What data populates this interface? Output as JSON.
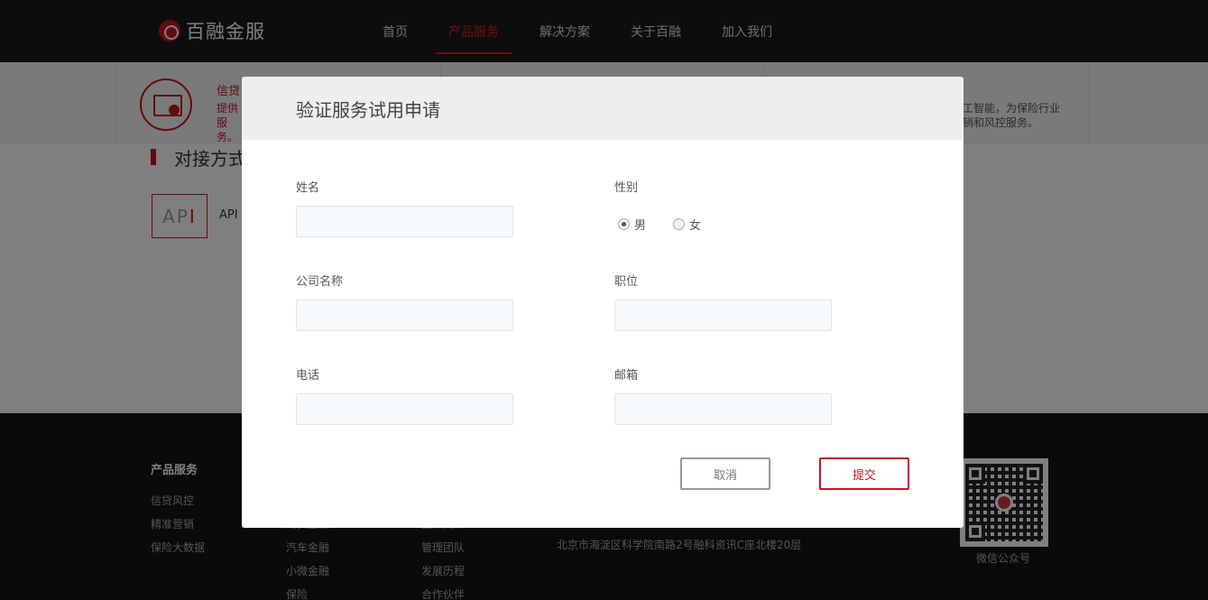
{
  "nav": {
    "logo_text": "百融金服",
    "items": [
      {
        "label": "首页",
        "active": false
      },
      {
        "label": "产品服务",
        "active": true
      },
      {
        "label": "解决方案",
        "active": false
      },
      {
        "label": "关于百融",
        "active": false
      },
      {
        "label": "加入我们",
        "active": false
      }
    ]
  },
  "submenu": {
    "credit_title": "信贷",
    "credit_desc": "提供 服务。",
    "right_desc": "工智能，为保险行业 销和风控服务。"
  },
  "content": {
    "section_title": "对接方式",
    "api_badge_a": "AP",
    "api_badge_b": "I",
    "api_label": "API"
  },
  "footer": {
    "title": "产品服务",
    "col1": [
      "信贷风控",
      "精准营销",
      "保险大数据"
    ],
    "col2": [
      "消费金融",
      "汽车金融",
      "小微金融",
      "保险"
    ],
    "col3": [
      "团队简介",
      "管理团队",
      "发展历程",
      "合作伙伴"
    ],
    "address": "北京市海淀区科学院南路2号融科资讯C座北楼20层",
    "qr_caption": "微信公众号"
  },
  "modal": {
    "title": "验证服务试用申请",
    "fields": {
      "name_label": "姓名",
      "name_value": "",
      "gender_label": "性别",
      "gender_options": [
        "男",
        "女"
      ],
      "gender_selected": "男",
      "company_label": "公司名称",
      "company_value": "",
      "position_label": "职位",
      "position_value": "",
      "phone_label": "电话",
      "phone_value": "",
      "email_label": "邮箱",
      "email_value": ""
    },
    "cancel_label": "取消",
    "submit_label": "提交"
  },
  "colors": {
    "brand_red": "#c4161c",
    "nav_bg": "#1a1a1a",
    "overlay": "rgba(0,0,0,0.5)"
  }
}
